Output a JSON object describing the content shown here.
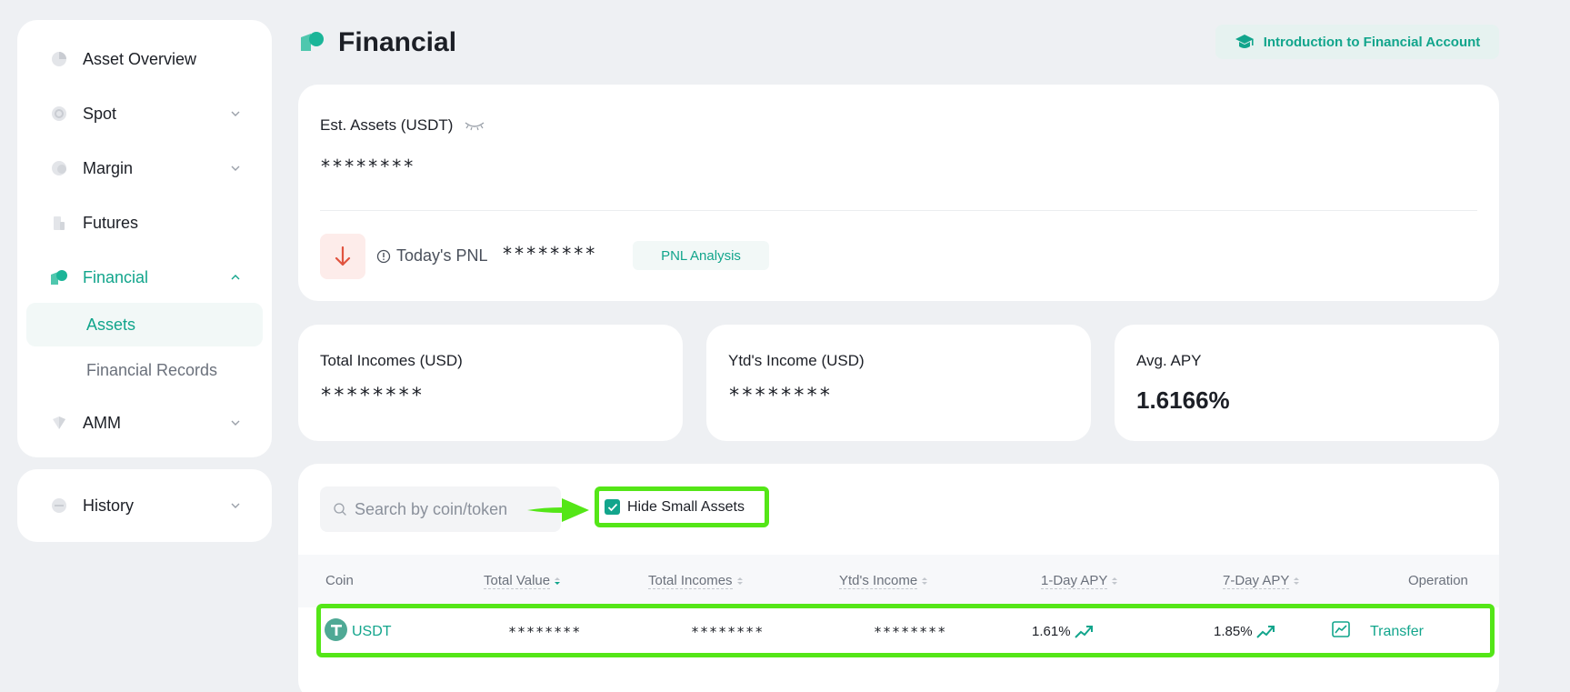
{
  "sidebar": {
    "items": [
      {
        "label": "Asset Overview",
        "icon": "pie-chart-icon"
      },
      {
        "label": "Spot",
        "icon": "spot-icon"
      },
      {
        "label": "Margin",
        "icon": "margin-icon"
      },
      {
        "label": "Futures",
        "icon": "futures-icon"
      },
      {
        "label": "Financial",
        "icon": "financial-icon"
      },
      {
        "label": "AMM",
        "icon": "amm-icon"
      }
    ],
    "sub_items": [
      {
        "label": "Assets"
      },
      {
        "label": "Financial Records"
      }
    ],
    "history": {
      "label": "History",
      "icon": "history-icon"
    }
  },
  "header": {
    "title": "Financial",
    "intro_button": "Introduction to Financial Account"
  },
  "summary": {
    "est_assets_label": "Est. Assets (USDT)",
    "est_assets_value": "********",
    "pnl_label": "Today's PNL",
    "pnl_value": "********",
    "pnl_button": "PNL Analysis"
  },
  "stats": {
    "total_incomes_label": "Total Incomes (USD)",
    "total_incomes_value": "********",
    "ytd_income_label": "Ytd's Income (USD)",
    "ytd_income_value": "********",
    "avg_apy_label": "Avg. APY",
    "avg_apy_value": "1.6166%"
  },
  "assets": {
    "search_placeholder": "Search by coin/token",
    "hide_small_label": "Hide Small Assets",
    "hide_small_checked": true,
    "columns": {
      "coin": "Coin",
      "total_value": "Total Value",
      "total_incomes": "Total Incomes",
      "ytd_income": "Ytd's Income",
      "apy_1d": "1-Day APY",
      "apy_7d": "7-Day APY",
      "operation": "Operation"
    },
    "rows": [
      {
        "coin": "USDT",
        "total_value": "********",
        "total_incomes": "********",
        "ytd_income": "********",
        "apy_1d": "1.61%",
        "apy_7d": "1.85%",
        "operation": "Transfer"
      }
    ]
  },
  "colors": {
    "accent": "#12a58c",
    "highlight": "#54e617",
    "pnl_down": "#e0533f"
  }
}
